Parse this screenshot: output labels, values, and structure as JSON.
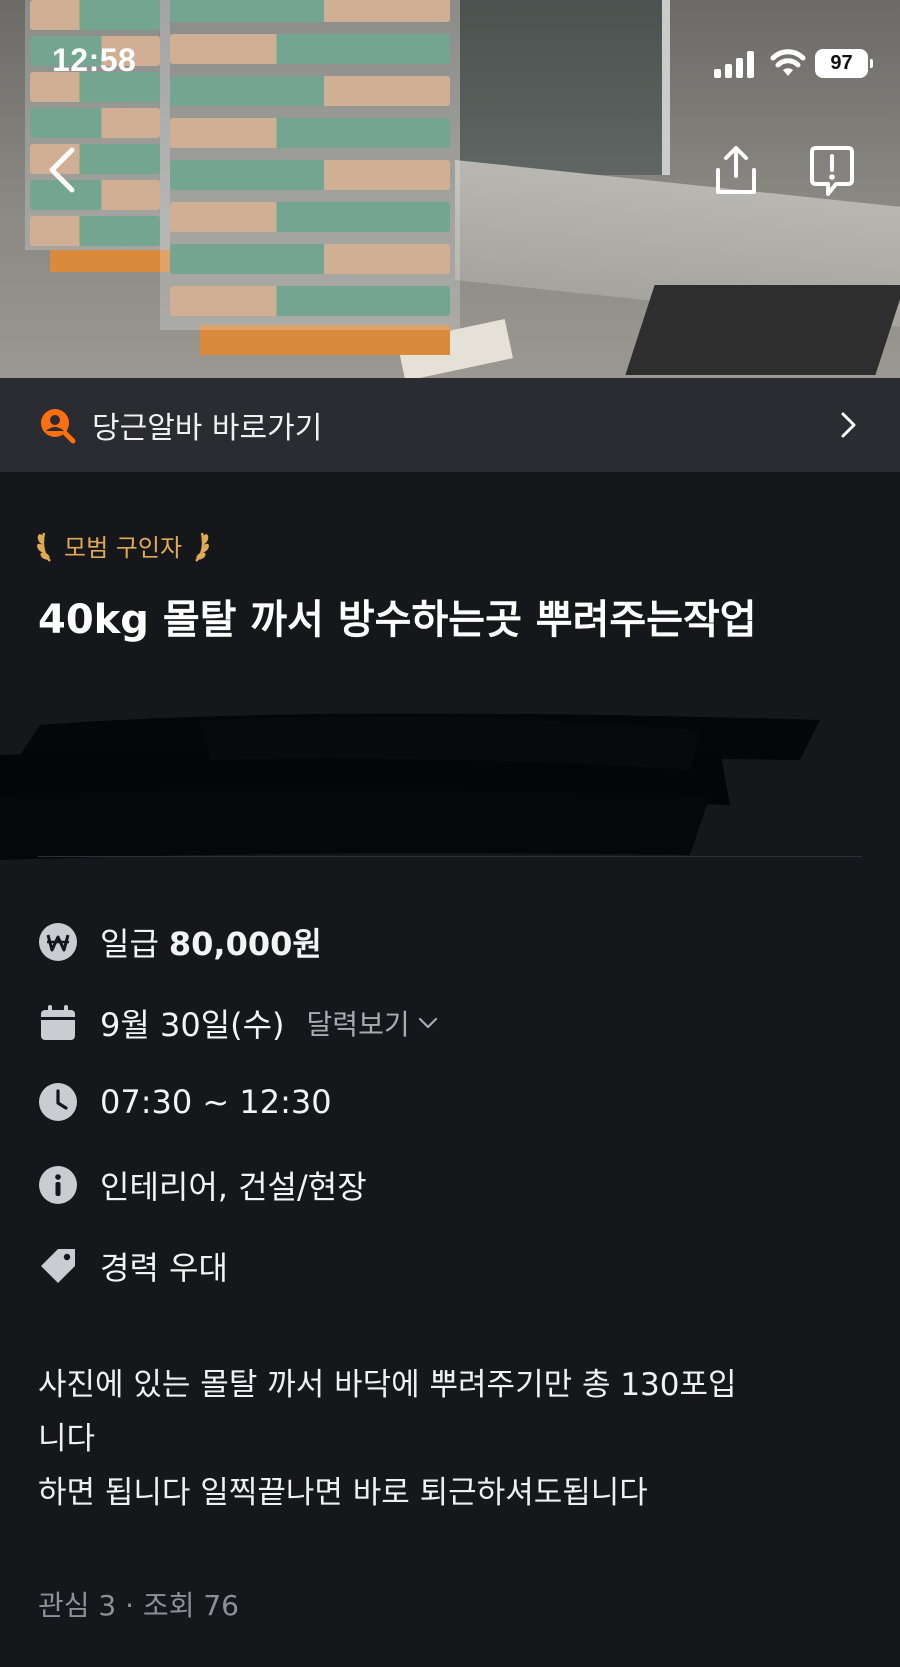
{
  "status_bar": {
    "time": "12:58",
    "battery": "97"
  },
  "banner": {
    "label": "당근알바 바로가기"
  },
  "post": {
    "badge": "모범 구인자",
    "title": "40kg 몰탈 까서 방수하는곳 뿌려주는작업"
  },
  "details": {
    "wage_prefix": "일급",
    "wage_amount": "80,000원",
    "date": "9월 30일(수)",
    "calendar_link": "달력보기",
    "time_range": "07:30 ~ 12:30",
    "category": "인테리어, 건설/현장",
    "preference": "경력 우대"
  },
  "description": {
    "line1": "사진에 있는 몰탈 까서 바닥에 뿌려주기만 총 130포입",
    "line2": "니다",
    "line3": "하면 됩니다 일찍끝나면 바로 퇴근하셔도됩니다"
  },
  "stats": {
    "text": "관심 3 · 조회 76"
  },
  "colors": {
    "accent": "#ff6f0f",
    "badge": "#e0a955",
    "background": "#15171b",
    "banner": "#2a2c31"
  }
}
